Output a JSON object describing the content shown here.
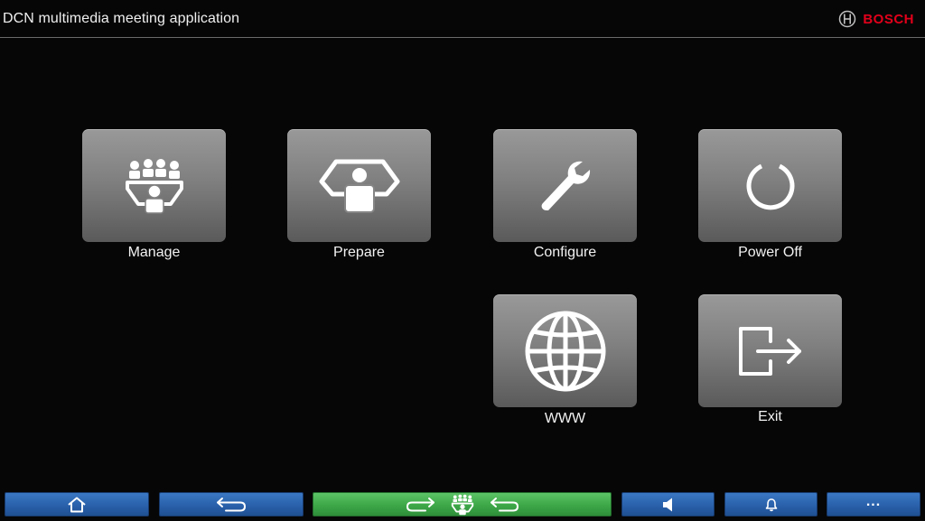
{
  "header": {
    "title": "DCN multimedia meeting application",
    "brand": "BOSCH",
    "brand_logo_icon": "bosch-armature-icon",
    "brand_color": "#e2001a"
  },
  "tiles": [
    {
      "label": "Manage",
      "icon": "group-people-icon"
    },
    {
      "label": "Prepare",
      "icon": "prepare-seat-icon"
    },
    {
      "label": "Configure",
      "icon": "wrench-icon"
    },
    {
      "label": "Power Off",
      "icon": "power-icon"
    },
    {
      "label": "WWW",
      "icon": "globe-icon"
    },
    {
      "label": "Exit",
      "icon": "exit-icon"
    }
  ],
  "bottom_bar": {
    "home_icon": "home-icon",
    "back_icon": "back-arrow-icon",
    "meeting_icons": [
      "forward-arrow-icon",
      "group-people-icon",
      "back-arrow-icon"
    ],
    "volume_icon": "speaker-icon",
    "alert_icon": "bell-icon",
    "more_label": "...",
    "accent_blue": "#2b63ad",
    "accent_green": "#3faa4a"
  }
}
